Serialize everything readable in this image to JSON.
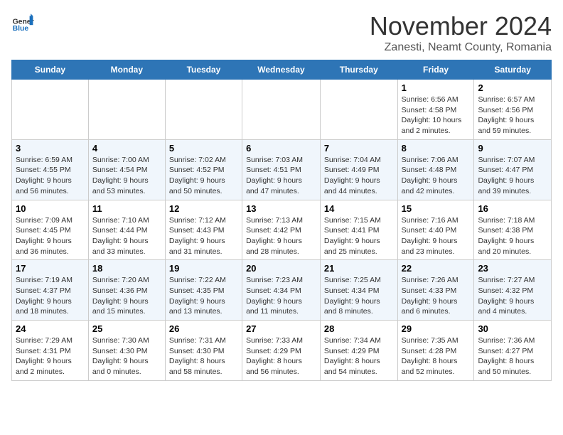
{
  "header": {
    "logo_general": "General",
    "logo_blue": "Blue",
    "month_title": "November 2024",
    "location": "Zanesti, Neamt County, Romania"
  },
  "weekdays": [
    "Sunday",
    "Monday",
    "Tuesday",
    "Wednesday",
    "Thursday",
    "Friday",
    "Saturday"
  ],
  "weeks": [
    [
      {
        "day": "",
        "info": ""
      },
      {
        "day": "",
        "info": ""
      },
      {
        "day": "",
        "info": ""
      },
      {
        "day": "",
        "info": ""
      },
      {
        "day": "",
        "info": ""
      },
      {
        "day": "1",
        "info": "Sunrise: 6:56 AM\nSunset: 4:58 PM\nDaylight: 10 hours and 2 minutes."
      },
      {
        "day": "2",
        "info": "Sunrise: 6:57 AM\nSunset: 4:56 PM\nDaylight: 9 hours and 59 minutes."
      }
    ],
    [
      {
        "day": "3",
        "info": "Sunrise: 6:59 AM\nSunset: 4:55 PM\nDaylight: 9 hours and 56 minutes."
      },
      {
        "day": "4",
        "info": "Sunrise: 7:00 AM\nSunset: 4:54 PM\nDaylight: 9 hours and 53 minutes."
      },
      {
        "day": "5",
        "info": "Sunrise: 7:02 AM\nSunset: 4:52 PM\nDaylight: 9 hours and 50 minutes."
      },
      {
        "day": "6",
        "info": "Sunrise: 7:03 AM\nSunset: 4:51 PM\nDaylight: 9 hours and 47 minutes."
      },
      {
        "day": "7",
        "info": "Sunrise: 7:04 AM\nSunset: 4:49 PM\nDaylight: 9 hours and 44 minutes."
      },
      {
        "day": "8",
        "info": "Sunrise: 7:06 AM\nSunset: 4:48 PM\nDaylight: 9 hours and 42 minutes."
      },
      {
        "day": "9",
        "info": "Sunrise: 7:07 AM\nSunset: 4:47 PM\nDaylight: 9 hours and 39 minutes."
      }
    ],
    [
      {
        "day": "10",
        "info": "Sunrise: 7:09 AM\nSunset: 4:45 PM\nDaylight: 9 hours and 36 minutes."
      },
      {
        "day": "11",
        "info": "Sunrise: 7:10 AM\nSunset: 4:44 PM\nDaylight: 9 hours and 33 minutes."
      },
      {
        "day": "12",
        "info": "Sunrise: 7:12 AM\nSunset: 4:43 PM\nDaylight: 9 hours and 31 minutes."
      },
      {
        "day": "13",
        "info": "Sunrise: 7:13 AM\nSunset: 4:42 PM\nDaylight: 9 hours and 28 minutes."
      },
      {
        "day": "14",
        "info": "Sunrise: 7:15 AM\nSunset: 4:41 PM\nDaylight: 9 hours and 25 minutes."
      },
      {
        "day": "15",
        "info": "Sunrise: 7:16 AM\nSunset: 4:40 PM\nDaylight: 9 hours and 23 minutes."
      },
      {
        "day": "16",
        "info": "Sunrise: 7:18 AM\nSunset: 4:38 PM\nDaylight: 9 hours and 20 minutes."
      }
    ],
    [
      {
        "day": "17",
        "info": "Sunrise: 7:19 AM\nSunset: 4:37 PM\nDaylight: 9 hours and 18 minutes."
      },
      {
        "day": "18",
        "info": "Sunrise: 7:20 AM\nSunset: 4:36 PM\nDaylight: 9 hours and 15 minutes."
      },
      {
        "day": "19",
        "info": "Sunrise: 7:22 AM\nSunset: 4:35 PM\nDaylight: 9 hours and 13 minutes."
      },
      {
        "day": "20",
        "info": "Sunrise: 7:23 AM\nSunset: 4:34 PM\nDaylight: 9 hours and 11 minutes."
      },
      {
        "day": "21",
        "info": "Sunrise: 7:25 AM\nSunset: 4:34 PM\nDaylight: 9 hours and 8 minutes."
      },
      {
        "day": "22",
        "info": "Sunrise: 7:26 AM\nSunset: 4:33 PM\nDaylight: 9 hours and 6 minutes."
      },
      {
        "day": "23",
        "info": "Sunrise: 7:27 AM\nSunset: 4:32 PM\nDaylight: 9 hours and 4 minutes."
      }
    ],
    [
      {
        "day": "24",
        "info": "Sunrise: 7:29 AM\nSunset: 4:31 PM\nDaylight: 9 hours and 2 minutes."
      },
      {
        "day": "25",
        "info": "Sunrise: 7:30 AM\nSunset: 4:30 PM\nDaylight: 9 hours and 0 minutes."
      },
      {
        "day": "26",
        "info": "Sunrise: 7:31 AM\nSunset: 4:30 PM\nDaylight: 8 hours and 58 minutes."
      },
      {
        "day": "27",
        "info": "Sunrise: 7:33 AM\nSunset: 4:29 PM\nDaylight: 8 hours and 56 minutes."
      },
      {
        "day": "28",
        "info": "Sunrise: 7:34 AM\nSunset: 4:29 PM\nDaylight: 8 hours and 54 minutes."
      },
      {
        "day": "29",
        "info": "Sunrise: 7:35 AM\nSunset: 4:28 PM\nDaylight: 8 hours and 52 minutes."
      },
      {
        "day": "30",
        "info": "Sunrise: 7:36 AM\nSunset: 4:27 PM\nDaylight: 8 hours and 50 minutes."
      }
    ]
  ]
}
